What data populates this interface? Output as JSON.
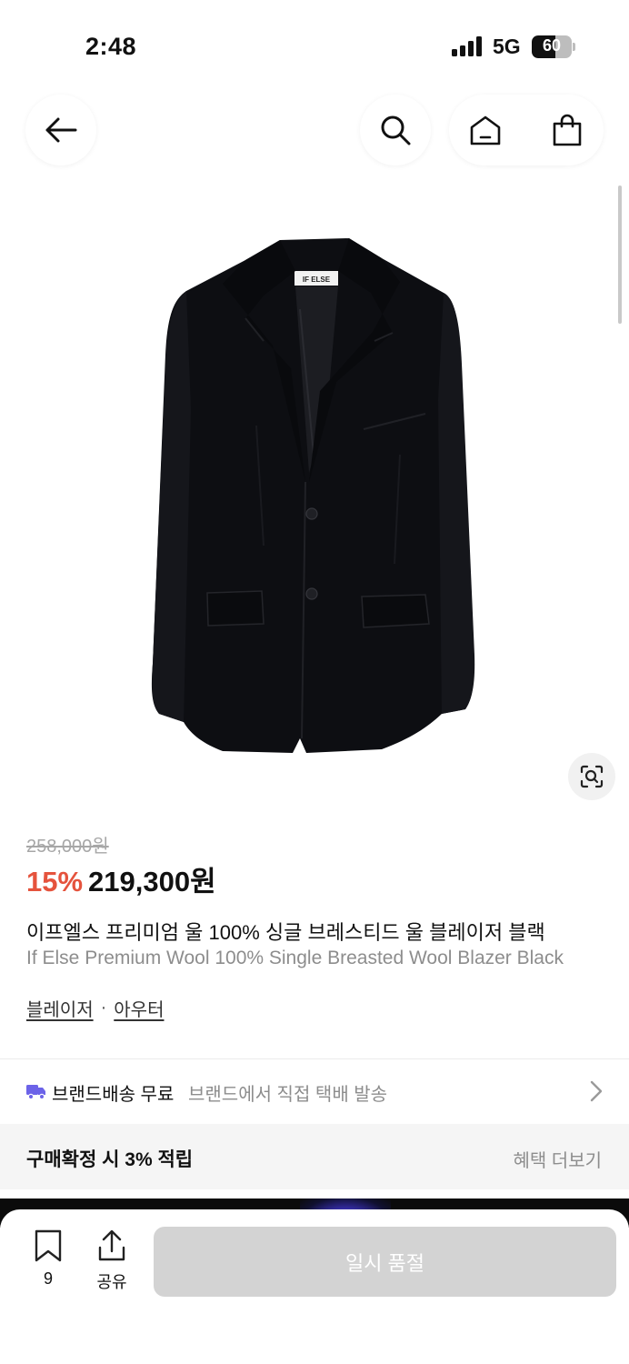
{
  "status_bar": {
    "time": "2:48",
    "network": "5G",
    "battery": "60",
    "battery_level": 0.6
  },
  "top_nav": {
    "back_icon": "arrow-left-icon",
    "search_icon": "search-icon",
    "home_icon": "home-icon",
    "cart_icon": "shopping-bag-icon"
  },
  "product": {
    "original_price": "258,000원",
    "discount": "15%",
    "sale_price": "219,300원",
    "title_ko": "이프엘스 프리미엄 울 100% 싱글 브레스티드 울 블레이저 블랙",
    "title_en": "If Else Premium Wool 100% Single Breasted Wool Blazer Black",
    "categories": [
      "블레이저",
      "아우터"
    ],
    "category_separator": "·",
    "image_label": "IF ELSE",
    "lens_icon": "visual-search-icon"
  },
  "shipping": {
    "label": "브랜드배송 무료",
    "description": "브랜드에서 직접 택배 발송",
    "icon": "truck-icon",
    "accent": "#6c63e8"
  },
  "benefit": {
    "label": "구매확정 시 3% 적립",
    "more": "혜택 더보기"
  },
  "bottom_bar": {
    "bookmark_count": "9",
    "share_label": "공유",
    "soldout_label": "일시 품절"
  },
  "colors": {
    "discount": "#e5533d",
    "muted": "#8d8d8d",
    "button_disabled": "#d3d3d3"
  }
}
